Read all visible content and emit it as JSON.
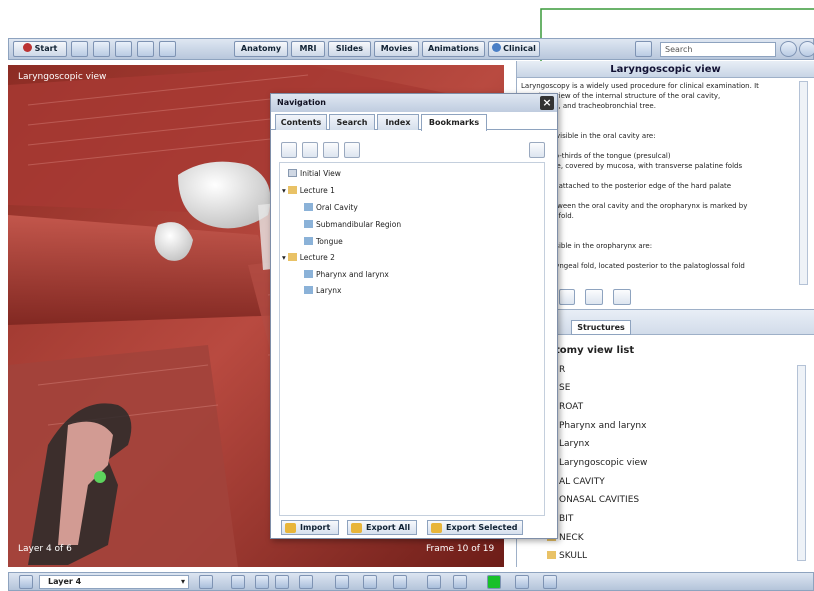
{
  "toolbar": {
    "start_label": "Start",
    "tabs": [
      "Anatomy",
      "MRI",
      "Slides",
      "Movies",
      "Animations",
      "Clinical"
    ],
    "search_placeholder": "Search"
  },
  "viewer": {
    "title": "Laryngoscopic view",
    "layer_text": "Layer 4 of 6",
    "frame_text": "Frame 10 of 19"
  },
  "info_panel": {
    "title": "Laryngoscopic view",
    "text_lines": [
      "Laryngoscopy is a widely used procedure for clinical examination. It",
      "r     clear view of the internal structure of the oral cavity,",
      "     , larynx, and tracheobronchial tree.",
      "",
      "     y",
      "     marks visible in the oral cavity are:",
      "",
      "     rior two-thirds of the tongue (presulcal)",
      "     d palate, covered by mucosa, with transverse palatine folds",
      "     teriorly",
      "     palate, attached to the posterior edge of the hard palate",
      "",
      "     ary between the oral cavity and the oropharynx is marked by",
      "     glossal fold.",
      "",
      "     nx",
      "     arks visible in the oropharynx are:",
      "",
      "     topharyngeal fold, located posterior to the palatoglossal fold"
    ],
    "tab_structures": "Structures",
    "list_title": "tomy view list",
    "list_items": [
      "R",
      "SE",
      "ROAT",
      "Pharynx and larynx",
      "Larynx",
      "Laryngoscopic view",
      "AL CAVITY",
      "ONASAL CAVITIES",
      "BIT",
      "NECK",
      "SKULL"
    ]
  },
  "navigation": {
    "title": "Navigation",
    "tabs": [
      "Contents",
      "Search",
      "Index",
      "Bookmarks"
    ],
    "active_tab": "Bookmarks",
    "tree": [
      {
        "label": "Initial View",
        "level": 0
      },
      {
        "label": "Lecture 1",
        "level": 0,
        "folder": true
      },
      {
        "label": "Oral Cavity",
        "level": 1
      },
      {
        "label": "Submandibular Region",
        "level": 1
      },
      {
        "label": "Tongue",
        "level": 1
      },
      {
        "label": "Lecture 2",
        "level": 0,
        "folder": true
      },
      {
        "label": "Pharynx and larynx",
        "level": 1
      },
      {
        "label": "Larynx",
        "level": 1
      }
    ],
    "buttons": {
      "import": "Import",
      "export_all": "Export All",
      "export_selected": "Export Selected"
    }
  },
  "bottombar": {
    "layer_select": "Layer 4"
  },
  "colors": {
    "callout_line": "#3a9a3a",
    "accent_green": "#19c02a",
    "toolbar_bg": "#c8d5e6"
  }
}
